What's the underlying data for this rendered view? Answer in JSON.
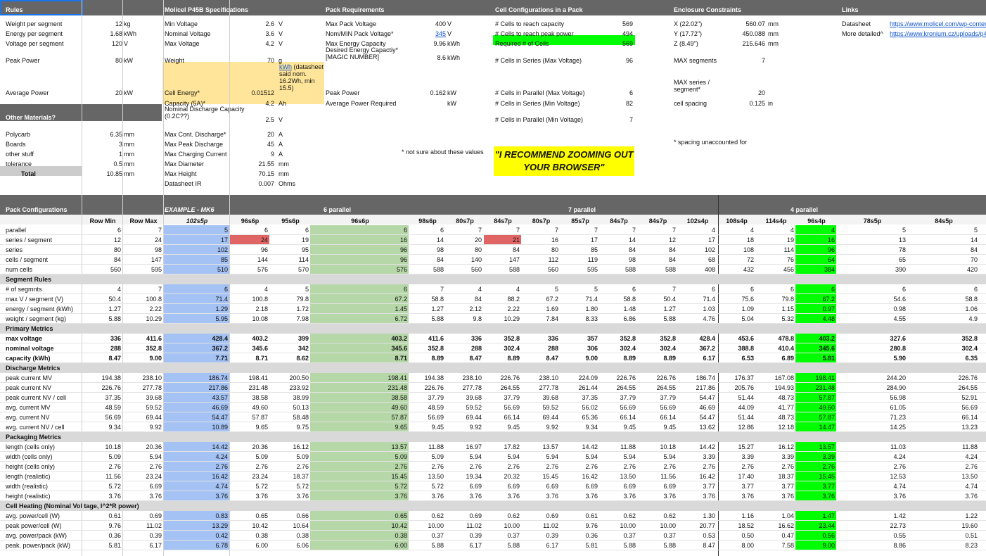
{
  "colors": {
    "header": "#666666",
    "blue": "#a4c2f4",
    "green_light": "#b6d7a8",
    "green": "#00ff00",
    "red": "#e06666",
    "orange": "#ffe599",
    "yellow": "#ffff00",
    "section": "#d9d9d9"
  },
  "rules": {
    "title": "Rules",
    "rows": [
      {
        "label": "Weight per segment",
        "value": "12",
        "unit": "kg"
      },
      {
        "label": "Energy per segment",
        "value": "1.68",
        "unit": "kWh"
      },
      {
        "label": "Voltage per segment",
        "value": "120",
        "unit": "V"
      },
      {
        "label": "Peak Power",
        "value": "80",
        "unit": "kW"
      },
      {
        "label": "Average Power",
        "value": "20",
        "unit": "kW"
      }
    ]
  },
  "other": {
    "title": "Other Materials?",
    "rows": [
      {
        "label": "Polycarb",
        "value": "6.35",
        "unit": "mm"
      },
      {
        "label": "Boards",
        "value": "3",
        "unit": "mm"
      },
      {
        "label": "other stuff",
        "value": "1",
        "unit": "mm"
      },
      {
        "label": "tolerance",
        "value": "0.5",
        "unit": "mm"
      },
      {
        "label": "Total",
        "value": "10.85",
        "unit": "mm"
      }
    ]
  },
  "molicel": {
    "title": "Molicel P45B Specifications",
    "rows": [
      {
        "label": "Min Voltage",
        "value": "2.6",
        "unit": "V"
      },
      {
        "label": "Nominal Voltage",
        "value": "3.6",
        "unit": "V"
      },
      {
        "label": "Max Voltage",
        "value": "4.2",
        "unit": "V"
      },
      {
        "label": "Weight",
        "value": "70",
        "unit": "g"
      },
      {
        "label": "Cell Energy*",
        "value": "0.01512",
        "unit": "kWh (datasheet said nom. 16.2Wh, min 15.5)",
        "unit_link": "kWh",
        "unit_rest": " (datasheet said nom. 16.2Wh, min 15.5)"
      },
      {
        "label": "Capacity (5A)*",
        "value": "4.2",
        "unit": "Ah"
      },
      {
        "label": "Nominal Discharge Capacity (0.2C??)",
        "value": "2.5",
        "unit": "V"
      },
      {
        "label": "Max Cont. Discharge*",
        "value": "20",
        "unit": "A"
      },
      {
        "label": "Max Peak Discharge",
        "value": "45",
        "unit": "A"
      },
      {
        "label": "Max Charging Current",
        "value": "9",
        "unit": "A"
      },
      {
        "label": "Max Diameter",
        "value": "21.55",
        "unit": "mm"
      },
      {
        "label": "Max Height",
        "value": "70.15",
        "unit": "mm"
      },
      {
        "label": "Datasheet IR",
        "value": "0.007",
        "unit": "Ohms"
      }
    ]
  },
  "pack": {
    "title": "Pack Requirements",
    "rows": [
      {
        "label": "Max Pack Voltage",
        "value": "400",
        "unit": "V"
      },
      {
        "label": "Nom/MIN Pack Voltage*",
        "value": "345",
        "unit": "V"
      },
      {
        "label": "Max Energy Capacity",
        "value": "9.96",
        "unit": "kWh"
      },
      {
        "label": "Desired Energy Capactiy* [MAGIC NUMBER]",
        "value": "8.6",
        "unit": "kWh"
      },
      {
        "label": "Peak Power",
        "value": "0.162",
        "unit": "kW"
      },
      {
        "label": "Average Power Required",
        "value": "",
        "unit": "kW"
      }
    ],
    "note": "* not sure about these values"
  },
  "cellcfg": {
    "title": "Cell Configurations in a Pack",
    "rows": [
      {
        "label": "# Cells to reach capacity",
        "value": "569"
      },
      {
        "label": "# Cells to reach peak power",
        "value": "494"
      },
      {
        "label": "Required # of Cells",
        "value": "569"
      },
      {
        "label": "# Cells in Series (Max Voltage)",
        "value": "96"
      },
      {
        "label": "# Cells in Parallel (Max Voltage)",
        "value": "6"
      },
      {
        "label": "# Cells in Series (Min Voltage)",
        "value": "82"
      },
      {
        "label": "# Cells in Parallel (Min Voltage)",
        "value": "7"
      }
    ]
  },
  "recommend": "\"I RECOMMEND ZOOMING OUT YOUR BROWSER\"",
  "enclosure": {
    "title": "Enclosure Constraints",
    "rows": [
      {
        "label": "X (22.02\")",
        "value": "560.07",
        "unit": "mm"
      },
      {
        "label": "Y (17.72\")",
        "value": "450.088",
        "unit": "mm"
      },
      {
        "label": "Z (8.49\")",
        "value": "215.646",
        "unit": "mm"
      },
      {
        "label": "MAX segments",
        "value": "7",
        "unit": ""
      },
      {
        "label": "MAX series / segment*",
        "value": "20",
        "unit": ""
      },
      {
        "label": "cell spacing",
        "value": "0.125",
        "unit": "in"
      }
    ],
    "note": "* spacing unaccounted for"
  },
  "links": {
    "title": "Links",
    "rows": [
      {
        "label": "Datasheet",
        "url": "https://www.molicel.com/wp-conten"
      },
      {
        "label": "More detailed^",
        "url": "https://www.kronium.cz/uploads/p4"
      }
    ]
  },
  "configs": {
    "title": "Pack Configurations",
    "group_labels": {
      "example": "EXAMPLE - MK6",
      "p6": "6 parallel",
      "p7": "7 parallel",
      "p4": "4 parallel"
    },
    "columns": [
      "Row Min",
      "Row Max",
      "102s5p",
      "96s6p",
      "95s6p",
      "96s6p",
      "98s6p",
      "80s7p",
      "84s7p",
      "80s7p",
      "85s7p",
      "84s7p",
      "84s7p",
      "102s4p",
      "108s4p",
      "114s4p",
      "96s4p",
      "78s5p",
      "84s5p"
    ],
    "rows": [
      {
        "type": "data",
        "label": "parallel",
        "values": [
          "6",
          "7",
          "5",
          "6",
          "6",
          "6",
          "6",
          "7",
          "7",
          "7",
          "7",
          "7",
          "7",
          "4",
          "4",
          "4",
          "4",
          "5",
          "5"
        ]
      },
      {
        "type": "data",
        "label": "series / segment",
        "values": [
          "12",
          "24",
          "17",
          "24",
          "19",
          "16",
          "14",
          "20",
          "21",
          "16",
          "17",
          "14",
          "12",
          "17",
          "18",
          "19",
          "16",
          "13",
          "14"
        ]
      },
      {
        "type": "data",
        "label": "series",
        "values": [
          "80",
          "98",
          "102",
          "96",
          "95",
          "96",
          "98",
          "80",
          "84",
          "80",
          "85",
          "84",
          "84",
          "102",
          "108",
          "114",
          "96",
          "78",
          "84"
        ]
      },
      {
        "type": "data",
        "label": "cells / segment",
        "values": [
          "84",
          "147",
          "85",
          "144",
          "114",
          "96",
          "84",
          "140",
          "147",
          "112",
          "119",
          "98",
          "84",
          "68",
          "72",
          "76",
          "64",
          "65",
          "70"
        ]
      },
      {
        "type": "data",
        "label": "num cells",
        "values": [
          "560",
          "595",
          "510",
          "576",
          "570",
          "576",
          "588",
          "560",
          "588",
          "560",
          "595",
          "588",
          "588",
          "408",
          "432",
          "456",
          "384",
          "390",
          "420"
        ]
      },
      {
        "type": "section",
        "label": "Segment Rules"
      },
      {
        "type": "data",
        "label": "# of segmnts",
        "values": [
          "4",
          "7",
          "6",
          "4",
          "5",
          "6",
          "7",
          "4",
          "4",
          "5",
          "5",
          "6",
          "7",
          "6",
          "6",
          "6",
          "6",
          "6",
          "6"
        ]
      },
      {
        "type": "data",
        "label": "max V / segment (V)",
        "values": [
          "50.4",
          "100.8",
          "71.4",
          "100.8",
          "79.8",
          "67.2",
          "58.8",
          "84",
          "88.2",
          "67.2",
          "71.4",
          "58.8",
          "50.4",
          "71.4",
          "75.6",
          "79.8",
          "67.2",
          "54.6",
          "58.8"
        ]
      },
      {
        "type": "data",
        "label": "energy / segment (kWh)",
        "values": [
          "1.27",
          "2.22",
          "1.29",
          "2.18",
          "1.72",
          "1.45",
          "1.27",
          "2.12",
          "2.22",
          "1.69",
          "1.80",
          "1.48",
          "1.27",
          "1.03",
          "1.09",
          "1.15",
          "0.97",
          "0.98",
          "1.06"
        ]
      },
      {
        "type": "data",
        "label": "weight / segment (kg)",
        "values": [
          "5.88",
          "10.29",
          "5.95",
          "10.08",
          "7.98",
          "6.72",
          "5.88",
          "9.8",
          "10.29",
          "7.84",
          "8.33",
          "6.86",
          "5.88",
          "4.76",
          "5.04",
          "5.32",
          "4.48",
          "4.55",
          "4.9"
        ]
      },
      {
        "type": "section",
        "label": "Primary Metrics"
      },
      {
        "type": "bold",
        "label": "max voltage",
        "values": [
          "336",
          "411.6",
          "428.4",
          "403.2",
          "399",
          "403.2",
          "411.6",
          "336",
          "352.8",
          "336",
          "357",
          "352.8",
          "352.8",
          "428.4",
          "453.6",
          "478.8",
          "403.2",
          "327.6",
          "352.8"
        ]
      },
      {
        "type": "bold",
        "label": "nominal voltage",
        "values": [
          "288",
          "352.8",
          "367.2",
          "345.6",
          "342",
          "345.6",
          "352.8",
          "288",
          "302.4",
          "288",
          "306",
          "302.4",
          "302.4",
          "367.2",
          "388.8",
          "410.4",
          "345.6",
          "280.8",
          "302.4"
        ]
      },
      {
        "type": "bold",
        "label": "capacity (kWh)",
        "values": [
          "8.47",
          "9.00",
          "7.71",
          "8.71",
          "8.62",
          "8.71",
          "8.89",
          "8.47",
          "8.89",
          "8.47",
          "9.00",
          "8.89",
          "8.89",
          "6.17",
          "6.53",
          "6.89",
          "5.81",
          "5.90",
          "6.35"
        ]
      },
      {
        "type": "section",
        "label": "Discharge Metrics"
      },
      {
        "type": "data",
        "label": "peak current MV",
        "values": [
          "194.38",
          "238.10",
          "186.74",
          "198.41",
          "200.50",
          "198.41",
          "194.38",
          "238.10",
          "226.76",
          "238.10",
          "224.09",
          "226.76",
          "226.76",
          "186.74",
          "176.37",
          "167.08",
          "198.41",
          "244.20",
          "226.76"
        ]
      },
      {
        "type": "data",
        "label": "peak current NV",
        "values": [
          "226.76",
          "277.78",
          "217.86",
          "231.48",
          "233.92",
          "231.48",
          "226.76",
          "277.78",
          "264.55",
          "277.78",
          "261.44",
          "264.55",
          "264.55",
          "217.86",
          "205.76",
          "194.93",
          "231.48",
          "284.90",
          "264.55"
        ]
      },
      {
        "type": "data",
        "label": "peak current NV / cell",
        "values": [
          "37.35",
          "39.68",
          "43.57",
          "38.58",
          "38.99",
          "38.58",
          "37.79",
          "39.68",
          "37.79",
          "39.68",
          "37.35",
          "37.79",
          "37.79",
          "54.47",
          "51.44",
          "48.73",
          "57.87",
          "56.98",
          "52.91"
        ]
      },
      {
        "type": "data",
        "label": "avg. current MV",
        "values": [
          "48.59",
          "59.52",
          "46.69",
          "49.60",
          "50.13",
          "49.60",
          "48.59",
          "59.52",
          "56.69",
          "59.52",
          "56.02",
          "56.69",
          "56.69",
          "46.69",
          "44.09",
          "41.77",
          "49.60",
          "61.05",
          "56.69"
        ]
      },
      {
        "type": "data",
        "label": "avg. current NV",
        "values": [
          "56.69",
          "69.44",
          "54.47",
          "57.87",
          "58.48",
          "57.87",
          "56.69",
          "69.44",
          "66.14",
          "69.44",
          "65.36",
          "66.14",
          "66.14",
          "54.47",
          "51.44",
          "48.73",
          "57.87",
          "71.23",
          "66.14"
        ]
      },
      {
        "type": "data",
        "label": "avg. current NV / cell",
        "values": [
          "9.34",
          "9.92",
          "10.89",
          "9.65",
          "9.75",
          "9.65",
          "9.45",
          "9.92",
          "9.45",
          "9.92",
          "9.34",
          "9.45",
          "9.45",
          "13.62",
          "12.86",
          "12.18",
          "14.47",
          "14.25",
          "13.23"
        ]
      },
      {
        "type": "section",
        "label": "Packaging Metrics"
      },
      {
        "type": "data",
        "label": "length (cells only)",
        "values": [
          "10.18",
          "20.36",
          "14.42",
          "20.36",
          "16.12",
          "13.57",
          "11.88",
          "16.97",
          "17.82",
          "13.57",
          "14.42",
          "11.88",
          "10.18",
          "14.42",
          "15.27",
          "16.12",
          "13.57",
          "11.03",
          "11.88"
        ]
      },
      {
        "type": "data",
        "label": "width (cells only)",
        "values": [
          "5.09",
          "5.94",
          "4.24",
          "5.09",
          "5.09",
          "5.09",
          "5.09",
          "5.94",
          "5.94",
          "5.94",
          "5.94",
          "5.94",
          "5.94",
          "3.39",
          "3.39",
          "3.39",
          "3.39",
          "4.24",
          "4.24"
        ]
      },
      {
        "type": "data",
        "label": "height (cells only)",
        "values": [
          "2.76",
          "2.76",
          "2.76",
          "2.76",
          "2.76",
          "2.76",
          "2.76",
          "2.76",
          "2.76",
          "2.76",
          "2.76",
          "2.76",
          "2.76",
          "2.76",
          "2.76",
          "2.76",
          "2.76",
          "2.76",
          "2.76"
        ]
      },
      {
        "type": "data",
        "label": "length (realistic)",
        "values": [
          "11.56",
          "23.24",
          "16.42",
          "23.24",
          "18.37",
          "15.45",
          "13.50",
          "19.34",
          "20.32",
          "15.45",
          "16.42",
          "13.50",
          "11.56",
          "16.42",
          "17.40",
          "18.37",
          "15.45",
          "12.53",
          "13.50"
        ]
      },
      {
        "type": "data",
        "label": "width (realistic)",
        "values": [
          "5.72",
          "6.69",
          "4.74",
          "5.72",
          "5.72",
          "5.72",
          "5.72",
          "6.69",
          "6.69",
          "6.69",
          "6.69",
          "6.69",
          "6.69",
          "3.77",
          "3.77",
          "3.77",
          "3.77",
          "4.74",
          "4.74"
        ]
      },
      {
        "type": "data",
        "label": "height (realistic)",
        "values": [
          "3.76",
          "3.76",
          "3.76",
          "3.76",
          "3.76",
          "3.76",
          "3.76",
          "3.76",
          "3.76",
          "3.76",
          "3.76",
          "3.76",
          "3.76",
          "3.76",
          "3.76",
          "3.76",
          "3.76",
          "3.76",
          "3.76"
        ]
      },
      {
        "type": "section",
        "label": "Cell Heating (Nominal Vol tage, I^2*R power)"
      },
      {
        "type": "data",
        "label": "avg. power/cell (W)",
        "values": [
          "0.61",
          "0.69",
          "0.83",
          "0.65",
          "0.66",
          "0.65",
          "0.62",
          "0.69",
          "0.62",
          "0.69",
          "0.61",
          "0.62",
          "0.62",
          "1.30",
          "1.16",
          "1.04",
          "1.47",
          "1.42",
          "1.22"
        ]
      },
      {
        "type": "data",
        "label": "peak power/cell (W)",
        "values": [
          "9.76",
          "11.02",
          "13.29",
          "10.42",
          "10.64",
          "10.42",
          "10.00",
          "11.02",
          "10.00",
          "11.02",
          "9.76",
          "10.00",
          "10.00",
          "20.77",
          "18.52",
          "16.62",
          "23.44",
          "22.73",
          "19.60"
        ]
      },
      {
        "type": "data",
        "label": "avg. power/pack (kW)",
        "values": [
          "0.36",
          "0.39",
          "0.42",
          "0.38",
          "0.38",
          "0.38",
          "0.37",
          "0.39",
          "0.37",
          "0.39",
          "0.36",
          "0.37",
          "0.37",
          "0.53",
          "0.50",
          "0.47",
          "0.56",
          "0.55",
          "0.51"
        ]
      },
      {
        "type": "data",
        "label": "peak. power/pack (kW)",
        "values": [
          "5.81",
          "6.17",
          "6.78",
          "6.00",
          "6.06",
          "6.00",
          "5.88",
          "6.17",
          "5.88",
          "6.17",
          "5.81",
          "5.88",
          "5.88",
          "8.47",
          "8.00",
          "7.58",
          "9.00",
          "8.86",
          "8.23"
        ]
      }
    ]
  }
}
